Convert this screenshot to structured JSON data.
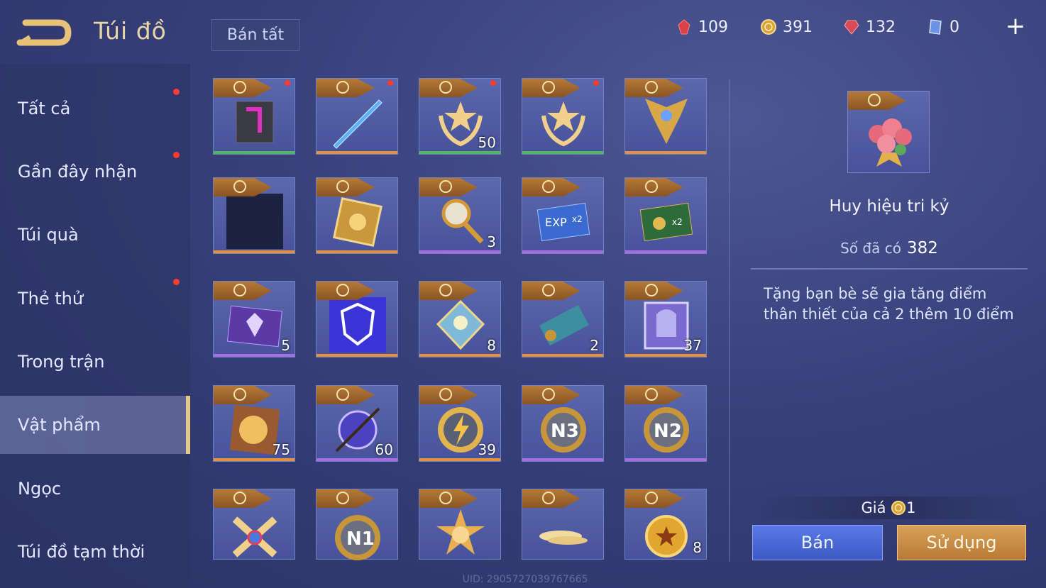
{
  "header": {
    "title": "Túi đồ",
    "sell_all_label": "Bán tất",
    "currencies": [
      {
        "icon": "red-crystal-icon",
        "value": "109",
        "color": "#e0404a"
      },
      {
        "icon": "gold-coin-icon",
        "value": "391",
        "color": "#e8b84a"
      },
      {
        "icon": "ruby-gem-icon",
        "value": "132",
        "color": "#e05060"
      },
      {
        "icon": "blue-ticket-icon",
        "value": "0",
        "color": "#8fb4ff"
      }
    ],
    "plus_label": "+"
  },
  "sidebar": {
    "items": [
      {
        "label": "Tất cả",
        "notify": true
      },
      {
        "label": "Gần đây nhận",
        "notify": true
      },
      {
        "label": "Túi quà",
        "notify": false
      },
      {
        "label": "Thẻ thử",
        "notify": true
      },
      {
        "label": "Trong trận",
        "notify": false
      },
      {
        "label": "Vật phẩm",
        "notify": false,
        "active": true
      },
      {
        "label": "Ngọc",
        "notify": false
      },
      {
        "label": "Túi đồ tạm thời",
        "notify": false
      }
    ]
  },
  "grid": {
    "items": [
      {
        "icon": "magenta-frame-icon",
        "count": "",
        "bar": "#4fb85a",
        "notify": true
      },
      {
        "icon": "blue-sword-icon",
        "count": "",
        "bar": "#e4913a",
        "notify": true
      },
      {
        "icon": "star-badge-icon",
        "count": "50",
        "bar": "#4fb85a",
        "notify": true
      },
      {
        "icon": "star-badge-icon",
        "count": "",
        "bar": "#4fb85a",
        "notify": true
      },
      {
        "icon": "winged-emblem-icon",
        "count": "",
        "bar": "#e4913a",
        "notify": false
      },
      {
        "icon": "empty-dark-icon",
        "count": "",
        "bar": "#e4913a",
        "notify": false
      },
      {
        "icon": "gold-card-icon",
        "count": "",
        "bar": "#e4913a",
        "notify": false
      },
      {
        "icon": "golden-key-icon",
        "count": "3",
        "bar": "#a86ee0",
        "notify": false
      },
      {
        "icon": "exp-x2-card-icon",
        "count": "",
        "bar": "#a86ee0",
        "notify": false
      },
      {
        "icon": "gold-x2-card-icon",
        "count": "",
        "bar": "#a86ee0",
        "notify": false
      },
      {
        "icon": "purple-card-icon",
        "count": "5",
        "bar": "#a86ee0",
        "notify": false
      },
      {
        "icon": "lion-shield-icon",
        "count": "",
        "bar": "#e4913a",
        "notify": false
      },
      {
        "icon": "spirit-diamond-icon",
        "count": "8",
        "bar": "#e4913a",
        "notify": false
      },
      {
        "icon": "scroll-icon",
        "count": "2",
        "bar": "#e4913a",
        "notify": false
      },
      {
        "icon": "helmet-card-icon",
        "count": "37",
        "bar": "#e4913a",
        "notify": false
      },
      {
        "icon": "gold-nugget-icon",
        "count": "75",
        "bar": "#e4913a",
        "notify": false
      },
      {
        "icon": "orb-icon",
        "count": "60",
        "bar": "#a86ee0",
        "notify": false
      },
      {
        "icon": "lightning-coin-icon",
        "count": "39",
        "bar": "#e4913a",
        "notify": false
      },
      {
        "icon": "n3-medal-icon",
        "count": "",
        "bar": "#a86ee0",
        "notify": false
      },
      {
        "icon": "n2-medal-icon",
        "count": "",
        "bar": "#a86ee0",
        "notify": false
      },
      {
        "icon": "x-badge-icon",
        "count": "",
        "bar": "",
        "notify": false
      },
      {
        "icon": "n1-medal-icon",
        "count": "",
        "bar": "",
        "notify": false
      },
      {
        "icon": "sun-badge-icon",
        "count": "",
        "bar": "",
        "notify": false
      },
      {
        "icon": "feathers-icon",
        "count": "",
        "bar": "",
        "notify": false
      },
      {
        "icon": "star-coin-icon",
        "count": "8",
        "bar": "",
        "notify": false
      }
    ]
  },
  "detail": {
    "icon": "rose-bouquet-icon",
    "name": "Huy hiệu tri kỷ",
    "owned_label": "Số đã có",
    "owned_value": "382",
    "description": "Tặng bạn bè sẽ gia tăng điểm thân thiết của cả 2 thêm 10 điểm",
    "price_label": "Giá",
    "price_value": "1",
    "sell_label": "Bán",
    "use_label": "Sử dụng"
  },
  "footer": {
    "uid": "UID: 2905727039767665"
  }
}
